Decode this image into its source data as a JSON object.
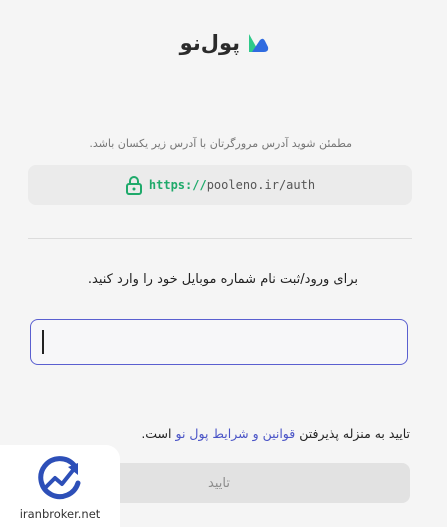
{
  "brand": {
    "name": "پول‌نو",
    "logo_icon": "pooleno-logo-icon",
    "colors": {
      "logo_green": "#2fc98a",
      "logo_blue": "#2f6be0"
    }
  },
  "security_notice": {
    "text": "مطمئن شوید آدرس مرورگرتان با آدرس زیر یکسان باشد.",
    "url_scheme": "https://",
    "url_rest": "pooleno.ir/auth",
    "icon": "lock-icon",
    "colors": {
      "lock": "#1faa6b"
    }
  },
  "login": {
    "instruction": "برای ورود/ثبت نام شماره موبایل خود را وارد کنید.",
    "phone_input": {
      "value": "",
      "placeholder": ""
    }
  },
  "terms": {
    "prefix": "تایید به منزله پذیرفتن",
    "link_text": "قوانین و شرایط پول نو",
    "suffix": "است."
  },
  "confirm_button": {
    "label": "تایید"
  },
  "watermark": {
    "text": "iranbroker.net",
    "icon": "iranbroker-chart-icon"
  },
  "accent_color": "#5a5fd0"
}
